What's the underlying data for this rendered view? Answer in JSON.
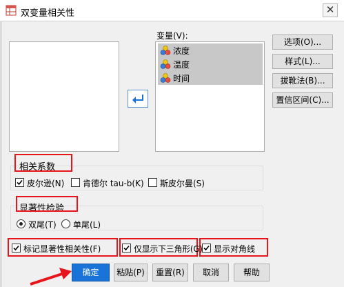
{
  "window": {
    "title": "双变量相关性",
    "close_glyph": "✕"
  },
  "variables": {
    "label": "变量(V):",
    "items": [
      {
        "label": "浓度"
      },
      {
        "label": "温度"
      },
      {
        "label": "时间"
      }
    ]
  },
  "side_buttons": [
    {
      "label": "选项(O)..."
    },
    {
      "label": "样式(L)..."
    },
    {
      "label": "拔靴法(B)..."
    },
    {
      "label": "置信区间(C)..."
    }
  ],
  "correlation": {
    "title": "相关系数",
    "options": [
      {
        "label": "皮尔逊(N)",
        "checked": true
      },
      {
        "label": "肯德尔 tau-b(K)",
        "checked": false
      },
      {
        "label": "斯皮尔曼(S)",
        "checked": false
      }
    ]
  },
  "significance": {
    "title": "显著性检验",
    "options": [
      {
        "label": "双尾(T)",
        "selected": true
      },
      {
        "label": "单尾(L)",
        "selected": false
      }
    ]
  },
  "flags": [
    {
      "label": "标记显著性相关性(F)",
      "checked": true
    },
    {
      "label": "仅显示下三角形(G)",
      "checked": true
    },
    {
      "label": "显示对角线",
      "checked": true
    }
  ],
  "footer_buttons": [
    {
      "label": "确定",
      "primary": true
    },
    {
      "label": "粘贴(P)"
    },
    {
      "label": "重置(R)"
    },
    {
      "label": "取消"
    },
    {
      "label": "帮助"
    }
  ],
  "colors": {
    "accent": "#1a73d9",
    "highlight": "#e8141c",
    "selection": "#c8c8c8"
  },
  "icons": {
    "app": "correlation-table-icon",
    "move": "move-arrow-icon",
    "variable": "scale-variable-icon"
  }
}
